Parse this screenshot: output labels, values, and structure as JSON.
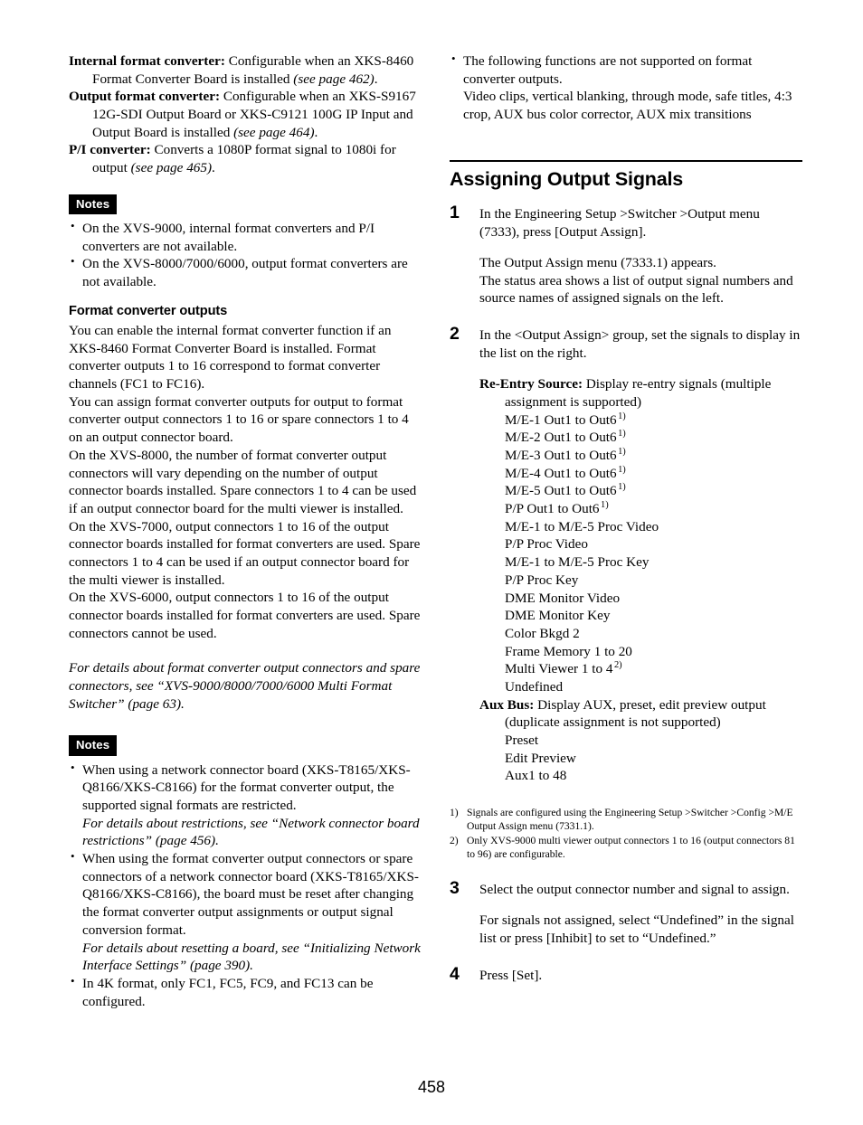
{
  "page_number": "458",
  "left_column": {
    "definitions": [
      {
        "term": "Internal format converter:",
        "text": " Configurable when an XKS-8460 Format Converter Board is installed ",
        "ref": "(see page 462)",
        "tail": "."
      },
      {
        "term": "Output format converter:",
        "text": " Configurable when an XKS-S9167 12G-SDI Output Board or XKS-C9121 100G IP Input and Output Board is installed ",
        "ref": "(see page 464)",
        "tail": "."
      },
      {
        "term": "P/I converter:",
        "text": " Converts a 1080P format signal to 1080i for output ",
        "ref": "(see page 465)",
        "tail": "."
      }
    ],
    "notes1": {
      "badge": "Notes",
      "items": [
        "On the XVS-9000, internal format converters and P/I converters are not available.",
        "On the XVS-8000/7000/6000, output format converters are not available."
      ]
    },
    "subheading": "Format converter outputs",
    "paragraphs": [
      "You can enable the internal format converter function if an XKS-8460 Format Converter Board is installed. Format converter outputs 1 to 16 correspond to format converter channels (FC1 to FC16).",
      "You can assign format converter outputs for output to format converter output connectors 1 to 16 or spare connectors 1 to 4 on an output connector board.",
      "On the XVS-8000, the number of format converter output connectors will vary depending on the number of output connector boards installed. Spare connectors 1 to 4 can be used if an output connector board for the multi viewer is installed.",
      "On the XVS-7000, output connectors 1 to 16 of the output connector boards installed for format converters are used. Spare connectors 1 to 4 can be used if an output connector board for the multi viewer is installed.",
      "On the XVS-6000, output connectors 1 to 16 of the output connector boards installed for format converters are used. Spare connectors cannot be used."
    ],
    "reference_italic": "For details about format converter output connectors and spare connectors, see “XVS-9000/8000/7000/6000 Multi Format Switcher” (page 63).",
    "notes2": {
      "badge": "Notes",
      "items": [
        {
          "text": "When using a network connector board (XKS-T8165/XKS-Q8166/XKS-C8166) for the format converter output, the supported signal formats are restricted.",
          "italic": "For details about restrictions, see “Network connector board restrictions” (page 456)."
        },
        {
          "text": "When using the format converter output connectors or spare connectors of a network connector board (XKS-T8165/XKS-Q8166/XKS-C8166), the board must be reset after changing the format converter output assignments or output signal conversion format.",
          "italic": "For details about resetting a board, see “Initializing Network Interface Settings” (page 390)."
        },
        {
          "text": "In 4K format, only FC1, FC5, FC9, and FC13 can be configured.",
          "italic": ""
        }
      ]
    }
  },
  "right_column": {
    "top_note": {
      "line1": "The following functions are not supported on format converter outputs.",
      "line2": "Video clips, vertical blanking, through mode, safe titles, 4:3 crop, AUX bus color corrector, AUX mix transitions"
    },
    "section_heading": "Assigning Output Signals",
    "steps": [
      {
        "num": "1",
        "body": "In the Engineering Setup >Switcher >Output menu (7333), press [Output Assign].",
        "body2_line1": "The Output Assign menu (7333.1) appears.",
        "body2_line2": "The status area shows a list of output signal numbers and source names of assigned signals on the left."
      },
      {
        "num": "2",
        "body": "In the <Output Assign> group, set the signals to display in the list on the right."
      },
      {
        "num": "3",
        "body": "Select the output connector number and signal to assign.",
        "body2": "For signals not assigned, select “Undefined” in the signal list or press [Inhibit] to set to “Undefined.”"
      },
      {
        "num": "4",
        "body": "Press [Set]."
      }
    ],
    "reentry": {
      "term": "Re-Entry Source:",
      "desc": " Display re-entry signals (multiple assignment is supported)",
      "options": [
        {
          "label": "M/E-1 Out1 to Out6",
          "sup": "1)"
        },
        {
          "label": "M/E-2 Out1 to Out6",
          "sup": "1)"
        },
        {
          "label": "M/E-3 Out1 to Out6",
          "sup": "1)"
        },
        {
          "label": "M/E-4 Out1 to Out6",
          "sup": "1)"
        },
        {
          "label": "M/E-5 Out1 to Out6",
          "sup": "1)"
        },
        {
          "label": "P/P Out1 to Out6",
          "sup": "1)"
        },
        {
          "label": "M/E-1 to M/E-5 Proc Video",
          "sup": ""
        },
        {
          "label": "P/P Proc Video",
          "sup": ""
        },
        {
          "label": "M/E-1 to M/E-5 Proc Key",
          "sup": ""
        },
        {
          "label": "P/P Proc Key",
          "sup": ""
        },
        {
          "label": "DME Monitor Video",
          "sup": ""
        },
        {
          "label": "DME Monitor Key",
          "sup": ""
        },
        {
          "label": "Color Bkgd 2",
          "sup": ""
        },
        {
          "label": "Frame Memory 1 to 20",
          "sup": ""
        },
        {
          "label": "Multi Viewer 1 to 4",
          "sup": "2)"
        },
        {
          "label": "Undefined",
          "sup": ""
        }
      ]
    },
    "auxbus": {
      "term": "Aux Bus:",
      "desc": " Display AUX, preset, edit preview output (duplicate assignment is not supported)",
      "options": [
        {
          "label": "Preset",
          "sup": ""
        },
        {
          "label": "Edit Preview",
          "sup": ""
        },
        {
          "label": "Aux1 to 48",
          "sup": ""
        }
      ]
    },
    "footnotes": [
      {
        "mark": "1)",
        "text": "Signals are configured using the Engineering Setup >Switcher >Config >M/E Output Assign menu (7331.1)."
      },
      {
        "mark": "2)",
        "text": "Only XVS-9000 multi viewer output connectors 1 to 16 (output connectors 81 to 96) are configurable."
      }
    ]
  }
}
